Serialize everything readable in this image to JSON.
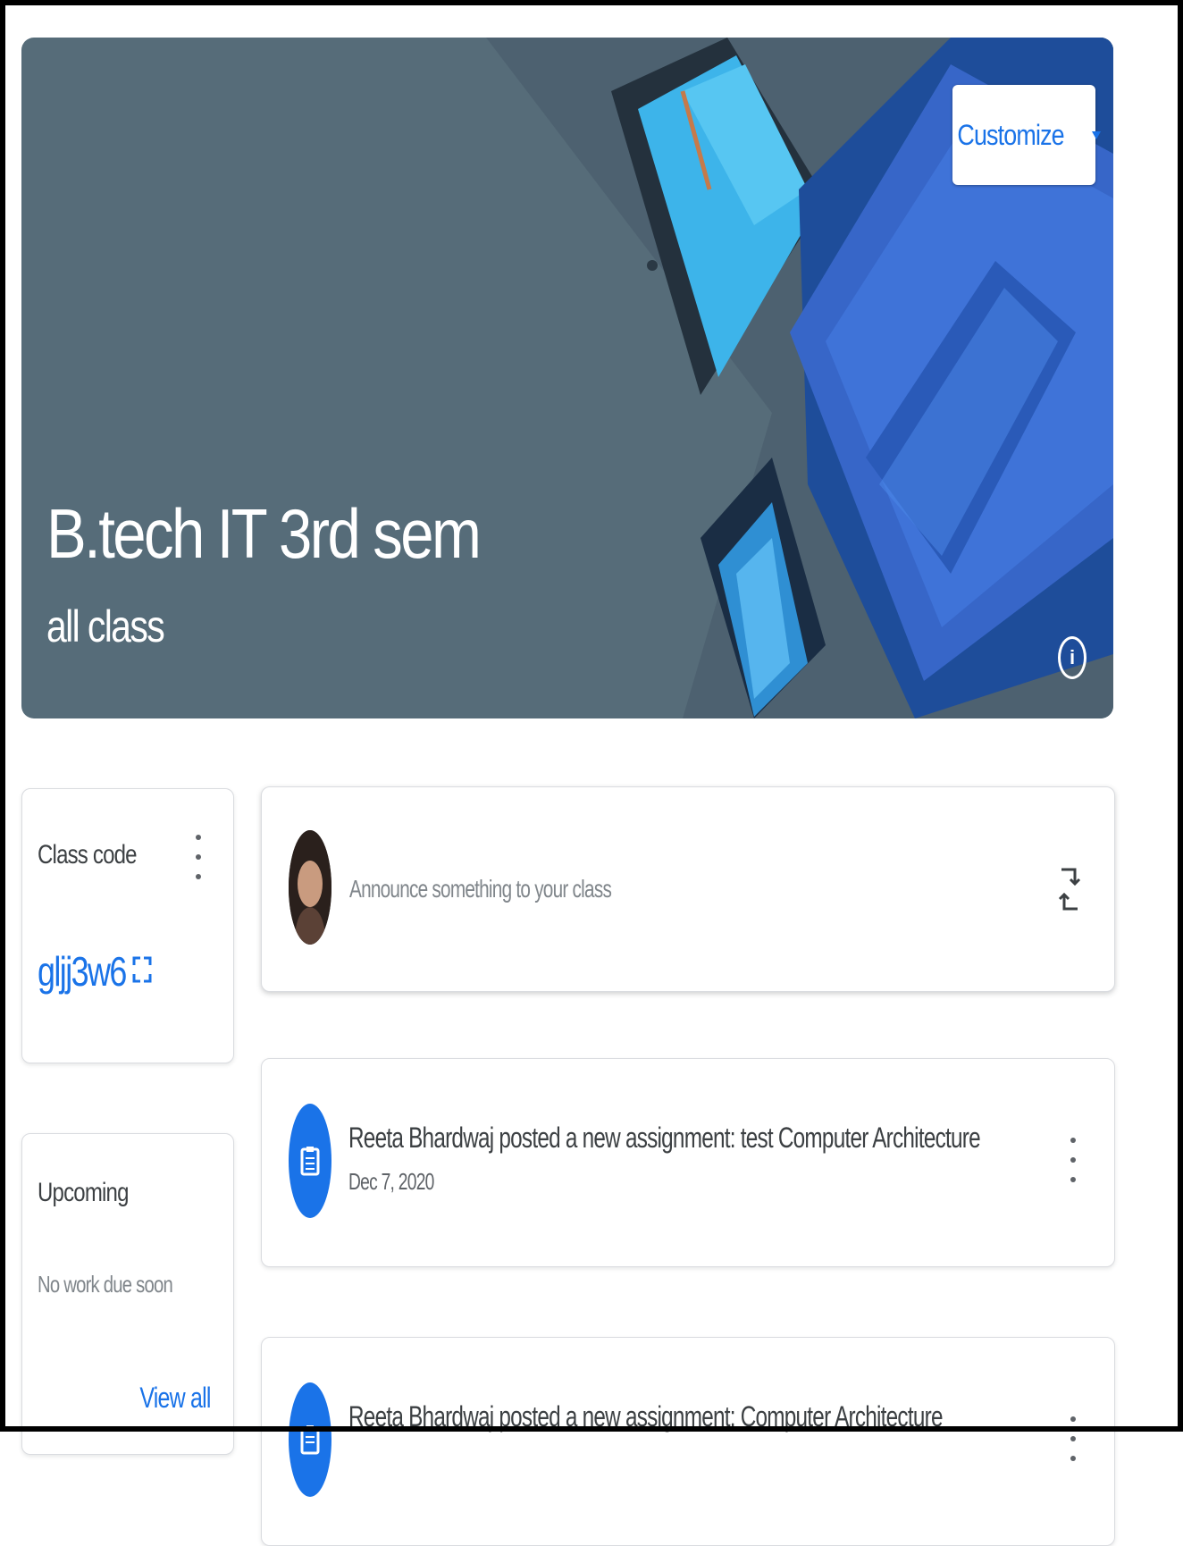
{
  "banner": {
    "title": "B.tech IT 3rd sem",
    "section": "all class",
    "customize_label": "Customize",
    "accent_color": "#1a73e8",
    "background_color": "#566c79"
  },
  "class_code": {
    "label": "Class code",
    "value": "gljj3w6"
  },
  "upcoming": {
    "label": "Upcoming",
    "empty_text": "No work due soon",
    "view_all_label": "View all"
  },
  "stream": {
    "announce_placeholder": "Announce something to your class",
    "posts": [
      {
        "title": "Reeta Bhardwaj posted a new assignment: test Computer Architecture",
        "date": "Dec 7, 2020",
        "icon": "assignment-icon"
      },
      {
        "title": "Reeta Bhardwaj posted a new assignment: Computer Architecture",
        "date": "",
        "icon": "assignment-icon"
      }
    ]
  },
  "icons": {
    "customize": "caret-down-icon",
    "info": "info-icon",
    "class_code_menu": "more-vert-icon",
    "class_code_display": "fullscreen-icon",
    "announce_action": "repost-icon",
    "post_menu": "more-vert-icon"
  }
}
